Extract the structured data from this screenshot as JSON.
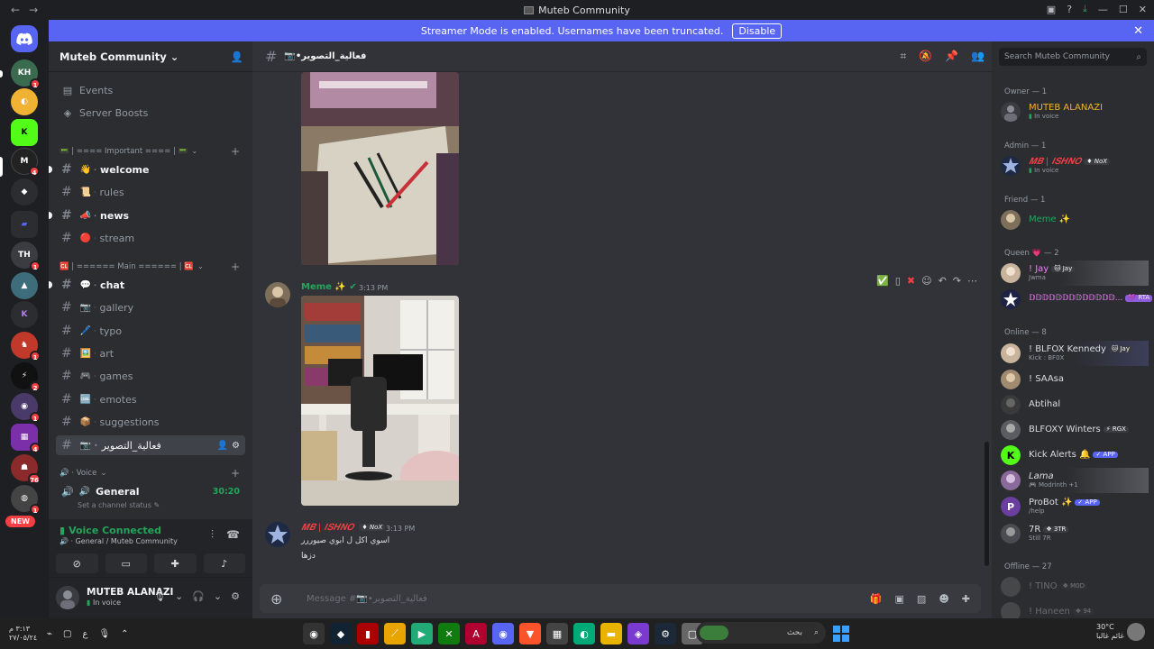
{
  "window": {
    "title": "Muteb Community",
    "back": "←",
    "forward": "→",
    "controls": [
      "—",
      "☐",
      "✕"
    ]
  },
  "banner": {
    "text": "Streamer Mode is enabled. Usernames have been truncated.",
    "button": "Disable"
  },
  "server_rail": {
    "new_label": "NEW",
    "badges": [
      "1",
      "4",
      "1",
      "1",
      "2",
      "1",
      "4",
      "76",
      "1"
    ]
  },
  "server": {
    "name": "Muteb Community"
  },
  "sidebar": {
    "top_items": [
      {
        "label": "Events",
        "icon": "calendar-icon"
      },
      {
        "label": "Server Boosts",
        "icon": "boost-icon"
      }
    ],
    "categories": [
      {
        "label": "📟 | ==== Important ==== | 📟"
      },
      {
        "label": "🆑 | ====== Main ====== | 🆑"
      },
      {
        "label": "🔊 · Voice"
      }
    ],
    "important_channels": [
      {
        "emoji": "👋",
        "name": "welcome",
        "unread": true
      },
      {
        "emoji": "📜",
        "name": "rules",
        "unread": false
      },
      {
        "emoji": "📣",
        "name": "news",
        "unread": true
      },
      {
        "emoji": "🔴",
        "name": "stream",
        "unread": false
      }
    ],
    "main_channels": [
      {
        "emoji": "💬",
        "name": "chat",
        "unread": true
      },
      {
        "emoji": "📷",
        "name": "gallery",
        "unread": false
      },
      {
        "emoji": "🖊️",
        "name": "typo",
        "unread": false
      },
      {
        "emoji": "🖼️",
        "name": "art",
        "unread": false
      },
      {
        "emoji": "🎮",
        "name": "games",
        "unread": false
      },
      {
        "emoji": "🆒",
        "name": "emotes",
        "unread": false
      },
      {
        "emoji": "📦",
        "name": "suggestions",
        "unread": false
      },
      {
        "emoji": "📷",
        "name": "فعالية_التصوير",
        "unread": false
      }
    ],
    "voice_channel": {
      "name": "General",
      "time": "30:20",
      "status": "Set a channel status"
    }
  },
  "voice_panel": {
    "title": "Voice Connected",
    "subtitle": "General / Muteb Community"
  },
  "user_panel": {
    "name": "MUTEB ALANAZI",
    "status": "In voice"
  },
  "channel_header": {
    "name": "📷•فعالية_التصوير"
  },
  "messages": [
    {
      "author": "Meme ✨",
      "time": "3:13 PM",
      "color": "#23a55a"
    },
    {
      "author": "𝑴𝑩 | 𝑰𝑺𝑯𝑵𝑶",
      "server_tag": "NoX",
      "time": "3:13 PM",
      "color": "#f23f43",
      "lines": [
        "اسوي اكل ل ابوي صيوررر",
        "دزها"
      ]
    }
  ],
  "composer": {
    "placeholder": "Message #📷•فعالية_التصوير"
  },
  "members": {
    "search_placeholder": "Search Muteb Community",
    "groups": [
      {
        "label": "Owner — 1",
        "members": [
          {
            "name": "MUTEB ALANAZI",
            "status": "In voice",
            "color": "#f0b232"
          }
        ]
      },
      {
        "label": "Admin — 1",
        "members": [
          {
            "name": "𝑴𝑩 | 𝑰𝑺𝑯𝑵𝑶",
            "tag": "NoX",
            "status": "In voice",
            "color": "#f23f43"
          }
        ]
      },
      {
        "label": "Friend — 1",
        "members": [
          {
            "name": "Meme ✨",
            "color": "#23a55a"
          }
        ]
      },
      {
        "label": "Queen 💗 — 2",
        "members": [
          {
            "name": "! Jay",
            "tag": "Jay",
            "status": "Jwma",
            "color": "#f47fff"
          },
          {
            "name": "𝔻𝔻𝔻𝔻𝔻𝔻𝔻𝔻𝔻𝔻𝔻𝔻𝔻...",
            "tag": "RTA",
            "color": "#f47fff"
          }
        ]
      },
      {
        "label": "Online — 8",
        "members": [
          {
            "name": "! BLFOX Kennedy",
            "tag": "Jay",
            "status": "Kick : BF0X",
            "color": "#dbdee1"
          },
          {
            "name": "! SAAsa",
            "color": "#dbdee1"
          },
          {
            "name": "Abtihal",
            "color": "#dbdee1"
          },
          {
            "name": "BLFOXY Winters",
            "tag": "RGX",
            "color": "#dbdee1"
          },
          {
            "name": "Kick Alerts 🔔",
            "app": "✓ APP",
            "color": "#dbdee1"
          },
          {
            "name": "Lama",
            "status": "Modrinth +1",
            "color": "#dbdee1"
          },
          {
            "name": "ProBot ✨",
            "app": "✓ APP",
            "status": "/help",
            "color": "#dbdee1"
          },
          {
            "name": "7R",
            "tag": "3TR",
            "status": "Still 7R",
            "color": "#dbdee1"
          }
        ]
      },
      {
        "label": "Offline — 27",
        "members": [
          {
            "name": "! TINO",
            "tag": "M0D",
            "color": "#80848e"
          },
          {
            "name": "! Haneen",
            "tag": "94",
            "color": "#80848e"
          }
        ]
      }
    ]
  },
  "taskbar": {
    "time": "٣:١٣ م",
    "date": "٢٧/٠٥/٢٤",
    "search_placeholder": "بحث",
    "weather_temp": "30°C",
    "weather_desc": "غائم غالبا"
  }
}
